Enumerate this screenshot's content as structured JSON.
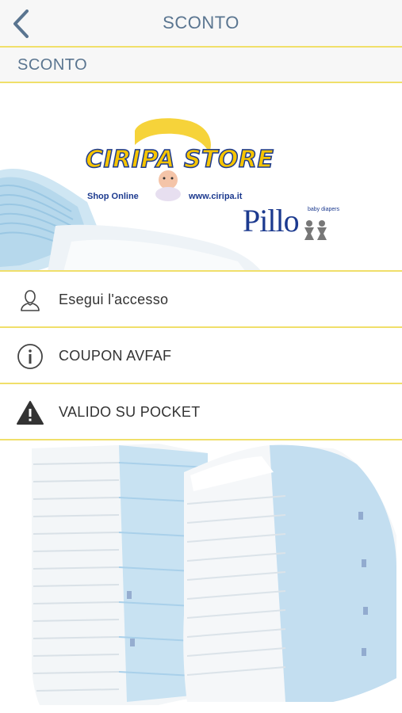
{
  "navbar": {
    "title": "SCONTO",
    "back_icon": "chevron-left-icon"
  },
  "section": {
    "title": "SCONTO"
  },
  "banner": {
    "logo_text": "CIRIPA STORE",
    "shop_online": "Shop Online",
    "site_url": "www.ciripa.it",
    "brand_name": "Pillo",
    "brand_tagline": "baby diapers"
  },
  "rows": [
    {
      "label": "Esegui l'accesso",
      "icon": "user-icon"
    },
    {
      "label": "COUPON AVFAF",
      "icon": "info-icon"
    },
    {
      "label": "VALIDO SU POCKET",
      "icon": "warning-icon"
    }
  ],
  "colors": {
    "accent_line": "#f0df6a",
    "title_text": "#5a7590",
    "header_bg": "#f7f7f7",
    "logo_yellow": "#f6c400",
    "logo_blue": "#1c3a8f"
  }
}
